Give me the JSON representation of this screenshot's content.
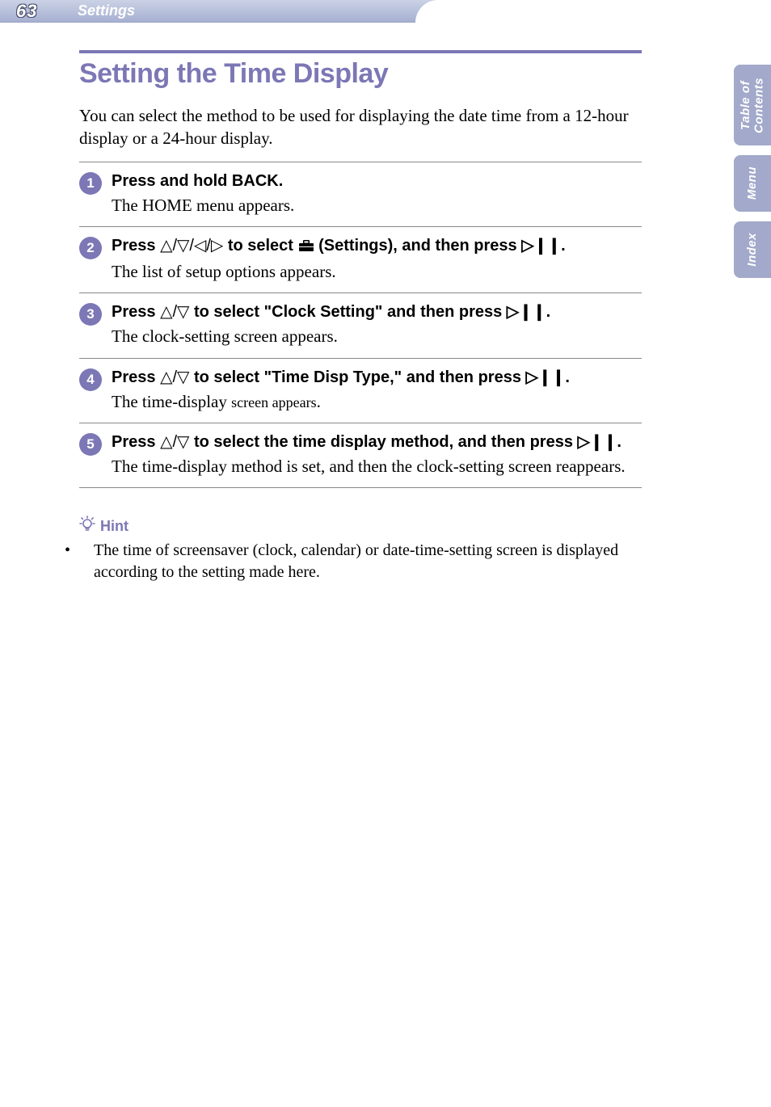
{
  "header": {
    "page_number": "63",
    "section": "Settings"
  },
  "side_tabs": [
    {
      "id": "toc",
      "label": "Table of\nContents"
    },
    {
      "id": "menu",
      "label": "Menu"
    },
    {
      "id": "index",
      "label": "Index"
    }
  ],
  "title": "Setting the Time Display",
  "intro": "You can select the method to be used for displaying the date time from a 12-hour display or a 24-hour display.",
  "glyphs": {
    "up": "△",
    "down": "▽",
    "left": "◁",
    "right": "▷",
    "play": "▷",
    "pause": "❙❙",
    "toolbox": "🧰"
  },
  "steps": [
    {
      "n": "1",
      "title_pre": "Press and hold BACK.",
      "title_glyphs": "",
      "title_post": "",
      "desc": "The HOME menu appears."
    },
    {
      "n": "2",
      "title_pre": "Press ",
      "title_glyphs": "△/▽/◁/▷",
      "title_mid": " to select ",
      "title_icon": "toolbox",
      "title_post": " (Settings), and then press ▷❙❙.",
      "desc": "The list of setup options appears."
    },
    {
      "n": "3",
      "title_pre": "Press ",
      "title_glyphs": "△/▽",
      "title_post": " to select \"Clock Setting\" and then press ▷❙❙.",
      "desc": "The clock-setting screen appears."
    },
    {
      "n": "4",
      "title_pre": "Press ",
      "title_glyphs": "△/▽",
      "title_post": " to select \"Time Disp Type,\" and then press ▷❙❙.",
      "desc_serif": "The time-display ",
      "desc_sans": "screen appears",
      "desc_tail": "."
    },
    {
      "n": "5",
      "title_pre": "Press ",
      "title_glyphs": "△/▽",
      "title_post": " to select the time display method, and then press ▷❙❙.",
      "desc": "The time-display method is set,  and then the clock-setting screen reappears."
    }
  ],
  "hint": {
    "label": "Hint",
    "text": "The time of screensaver (clock, calendar) or date-time-setting screen is displayed according to the setting made here."
  }
}
